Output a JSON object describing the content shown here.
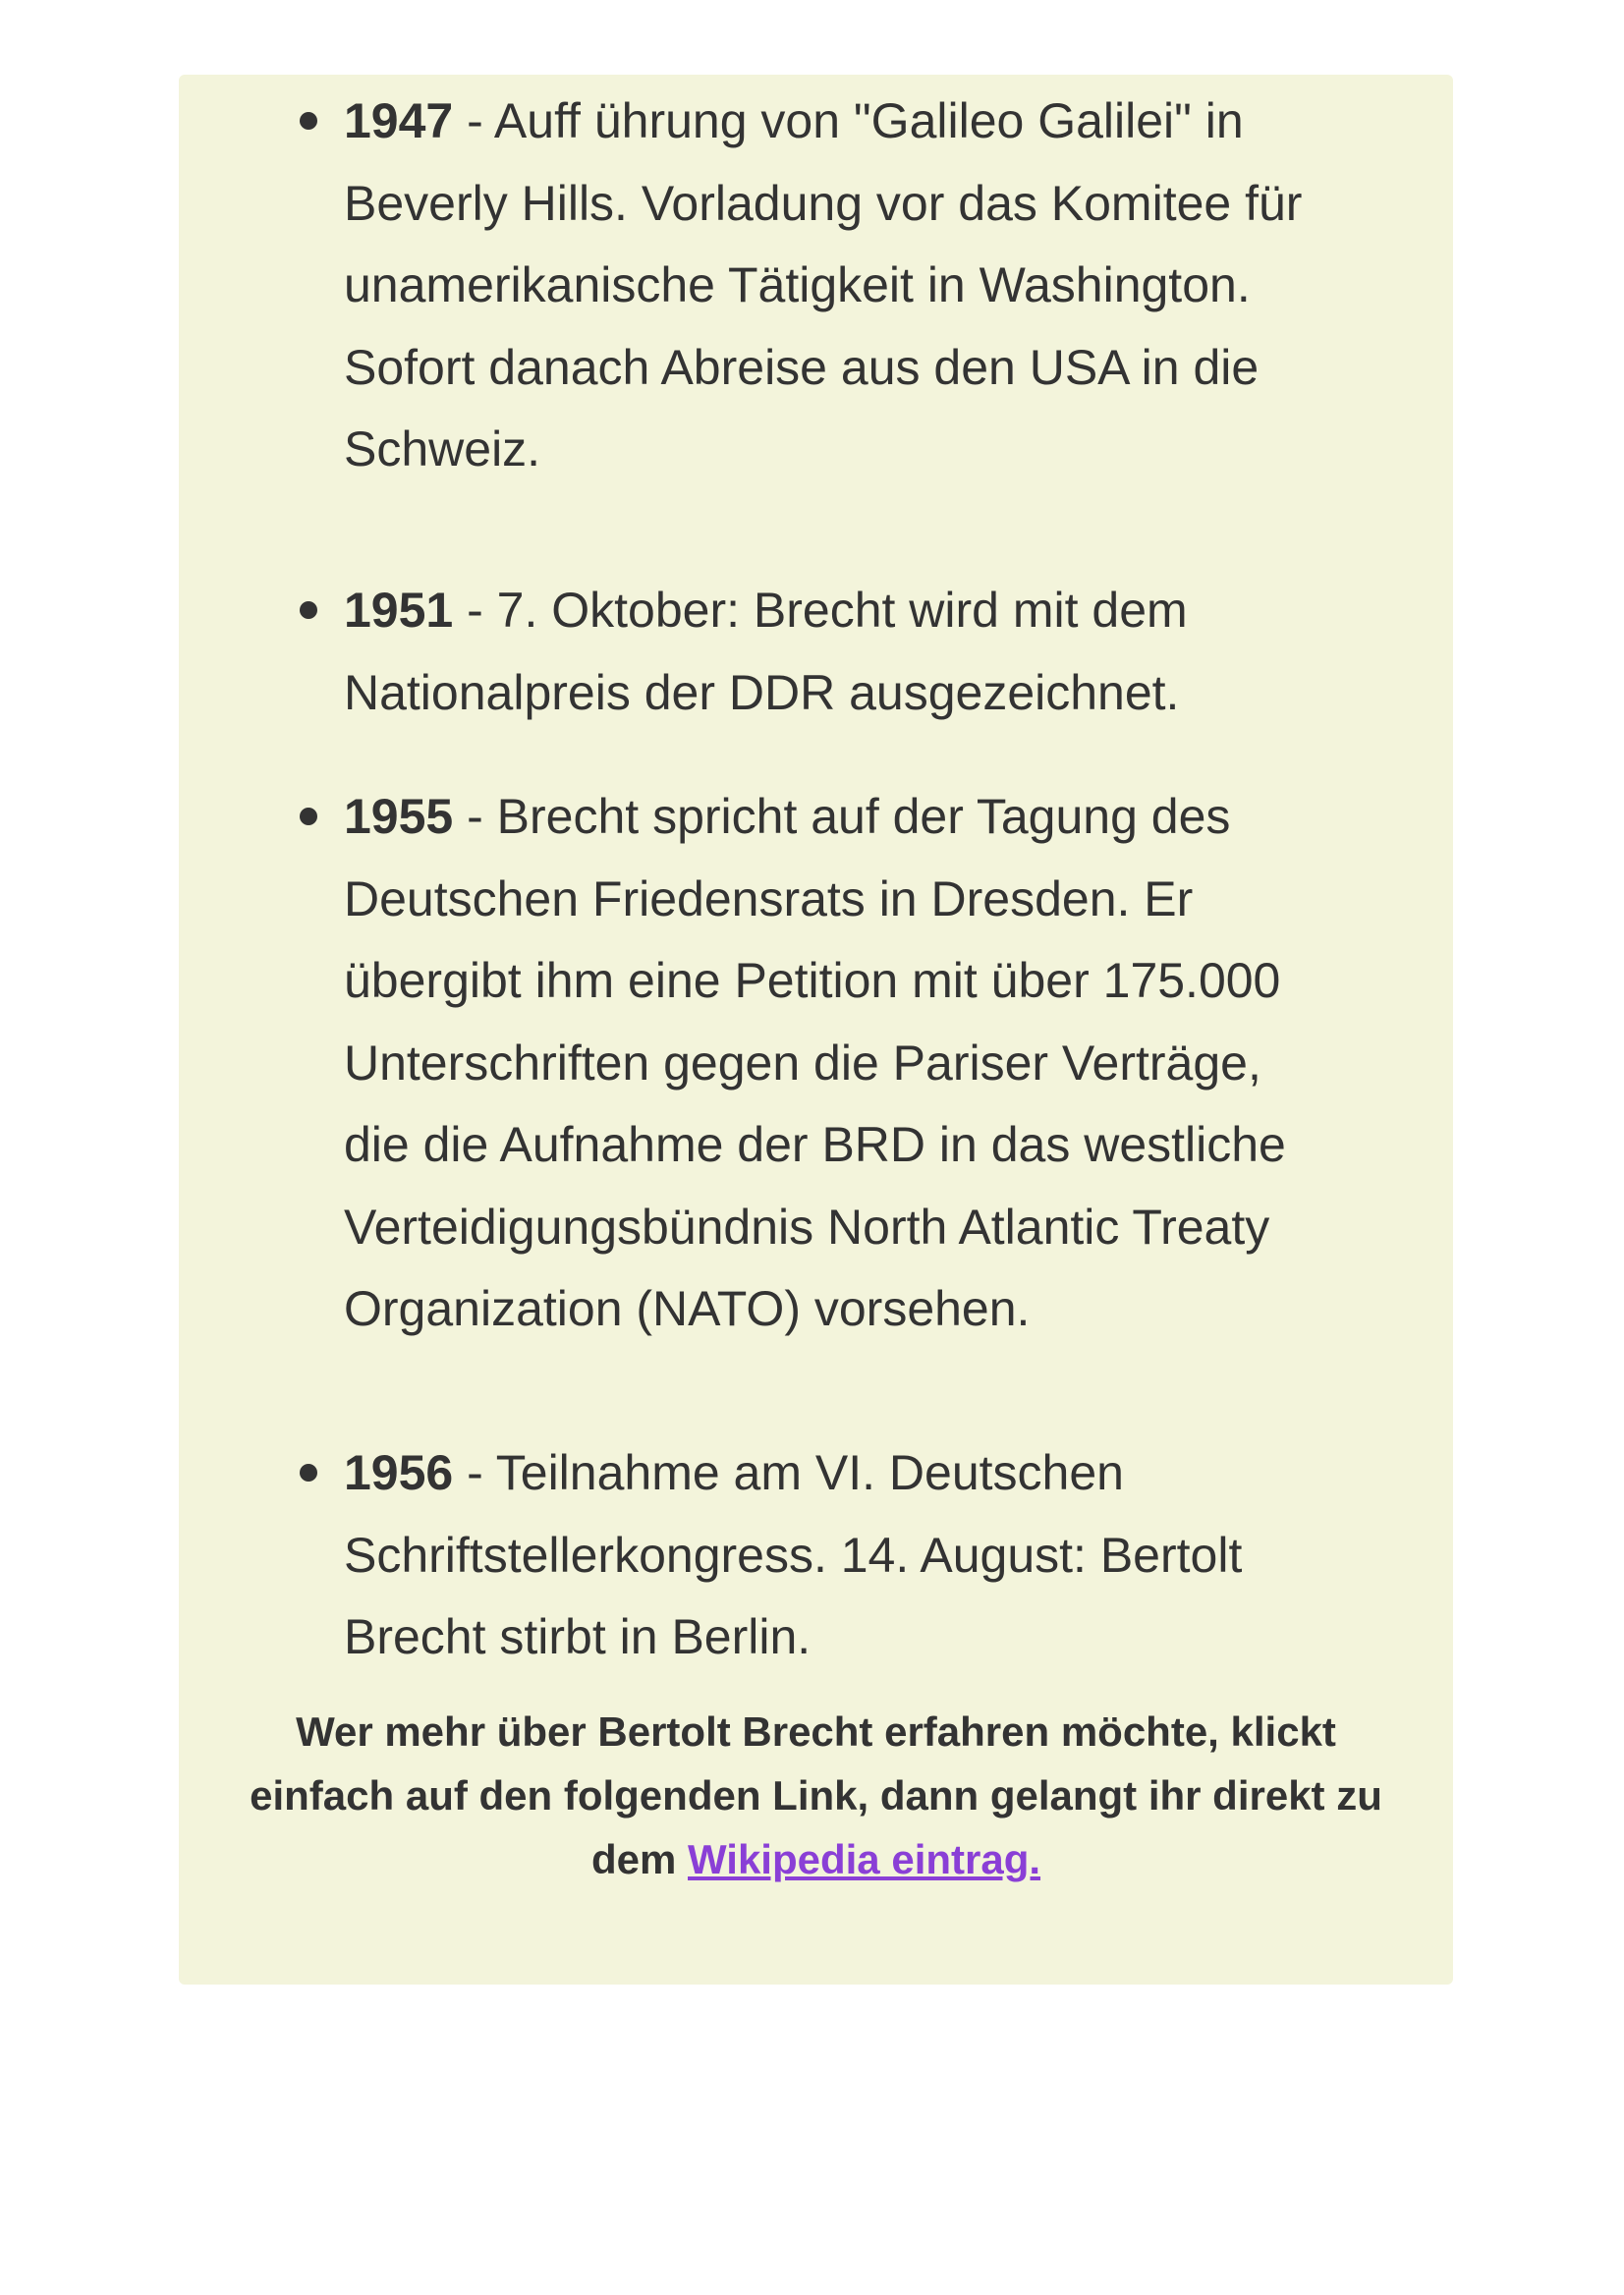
{
  "timeline": {
    "entries": [
      {
        "year": "1947",
        "lines": [
          " - Auff ührung von \"Galileo Galilei\" in",
          "Beverly Hills. Vorladung vor das Komitee für",
          "unamerikanische Tätigkeit in Washington.",
          "Sofort danach Abreise aus den USA in die",
          "Schweiz."
        ]
      },
      {
        "year": "1951",
        "lines": [
          " - 7. Oktober: Brecht wird mit dem",
          "Nationalpreis der DDR ausgezeichnet."
        ]
      },
      {
        "year": "1955",
        "lines": [
          " - Brecht spricht auf der Tagung des",
          "Deutschen Friedensrats in Dresden. Er",
          "übergibt ihm eine Petition mit über 175.000",
          "Unterschriften gegen die Pariser Verträge,",
          "die die Aufnahme der BRD in das westliche",
          "Verteidigungsbündnis North Atlantic Treaty",
          "Organization (NATO) vorsehen."
        ]
      },
      {
        "year": "1956",
        "lines": [
          " - Teilnahme am VI. Deutschen",
          "Schriftstellerkongress. 14. August: Bertolt",
          "Brecht stirbt in Berlin."
        ]
      }
    ]
  },
  "footer": {
    "line1": "Wer mehr über Bertolt Brecht erfahren möchte, klickt",
    "line2": "einfach auf den folgenden Link, dann gelangt ihr direkt zu",
    "line3_prefix": "dem ",
    "link_label": "Wikipedia eintrag."
  },
  "colors": {
    "card_background": "#f3f4db",
    "text": "#333333",
    "link": "#8a3fd6"
  }
}
